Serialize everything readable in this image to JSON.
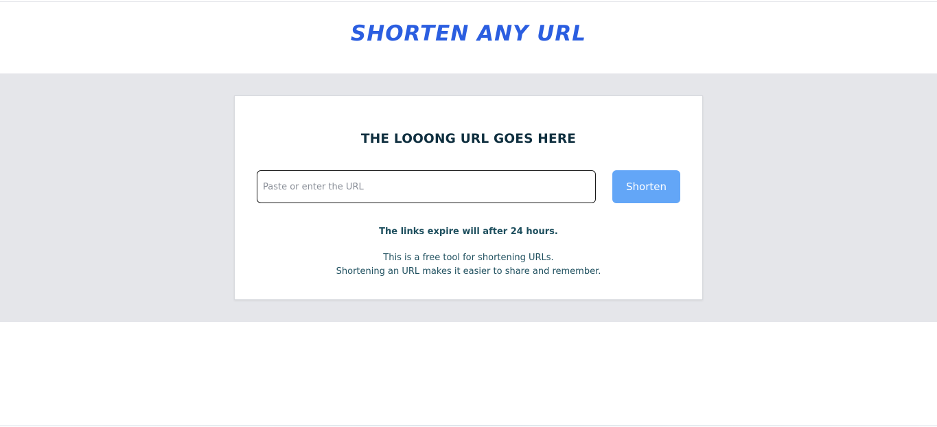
{
  "header": {
    "title": "SHORTEN ANY URL"
  },
  "card": {
    "heading": "THE LOOONG URL GOES HERE",
    "url_input": {
      "value": "",
      "placeholder": "Paste or enter the URL"
    },
    "shorten_button_label": "Shorten",
    "expire_note": "The links expire will after 24 hours.",
    "description_lines": [
      "This is a free tool for shortening URLs.",
      "Shortening an URL makes it easier to share and remember."
    ]
  },
  "colors": {
    "brand_title": "#2b5ee0",
    "band_background": "#e5e6ea",
    "button_background": "#63a6f7",
    "heading_text": "#0f2f3f",
    "body_text": "#1e4f5e"
  }
}
